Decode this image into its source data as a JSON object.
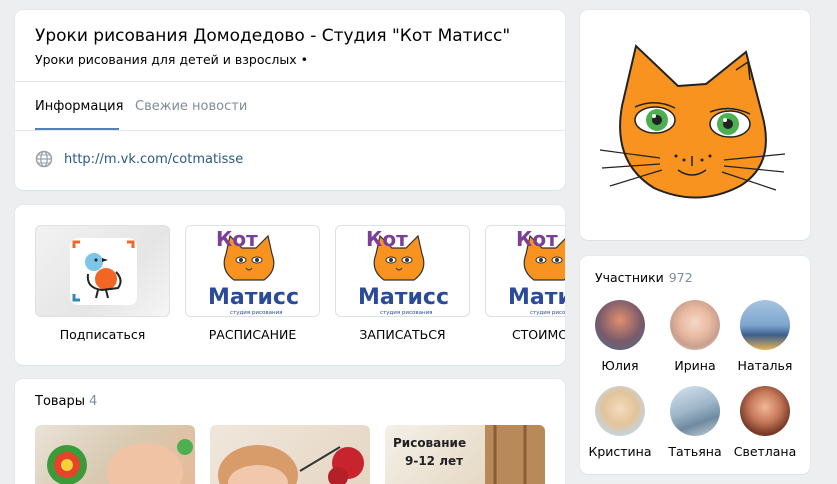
{
  "group": {
    "title": "Уроки рисования Домодедово - Студия \"Кот Матисс\"",
    "status": "Уроки рисования для детей и взрослых •"
  },
  "tabs": [
    {
      "label": "Информация",
      "active": true
    },
    {
      "label": "Свежие новости",
      "active": false
    }
  ],
  "info": {
    "site_icon": "globe-icon",
    "site_url": "http://m.vk.com/cotmatisse"
  },
  "links": [
    {
      "label": "Подписаться",
      "image": "bird-icon"
    },
    {
      "label": "РАСПИСАНИЕ",
      "image": "kot-matiss-logo"
    },
    {
      "label": "ЗАПИСАТЬСЯ",
      "image": "kot-matiss-logo"
    },
    {
      "label": "СТОИМОСТЬ",
      "image": "kot-matiss-logo"
    }
  ],
  "logo": {
    "word_top": "Кот",
    "word_bottom": "Матисс",
    "caption": "студия рисования"
  },
  "goods": {
    "title": "Товары",
    "count": "4",
    "items": [
      {
        "overlay": ""
      },
      {
        "overlay": ""
      },
      {
        "overlay": "Рисование\n9-12 лет"
      }
    ]
  },
  "members": {
    "title": "Участники",
    "count": "972",
    "list": [
      {
        "name": "Юлия"
      },
      {
        "name": "Ирина"
      },
      {
        "name": "Наталья"
      },
      {
        "name": "Кристина"
      },
      {
        "name": "Татьяна"
      },
      {
        "name": "Светлана"
      }
    ]
  },
  "colors": {
    "link": "#2a5885",
    "accent": "#5181b8",
    "muted": "#818c99",
    "cat_orange": "#f7931e"
  }
}
